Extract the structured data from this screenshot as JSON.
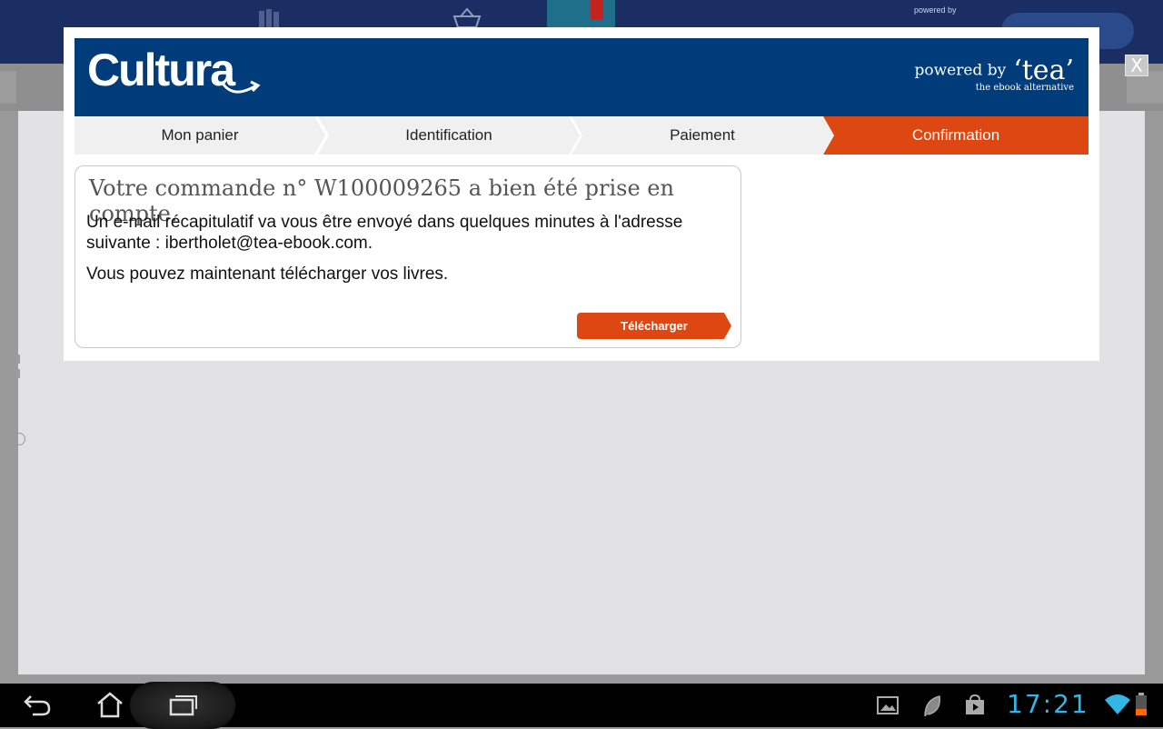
{
  "background_app": {
    "topbar_powered_by": "powered by"
  },
  "modal": {
    "brand": {
      "logo_text": "Cultura",
      "powered_by": "powered by",
      "tea": "‘tea’",
      "tagline": "the ebook alternative"
    },
    "steps": [
      {
        "label": "Mon panier",
        "active": false
      },
      {
        "label": "Identification",
        "active": false
      },
      {
        "label": "Paiement",
        "active": false
      },
      {
        "label": "Confirmation",
        "active": true
      }
    ],
    "confirmation": {
      "title": "Votre commande n° W100009265 a bien été prise en compte.",
      "email_message": "Un e-mail récapitulatif va vous être envoyé dans quelques minutes à l'adresse suivante : ibertholet@tea-ebook.com.",
      "download_message": "Vous pouvez maintenant télécharger vos livres.",
      "download_button": "Télécharger"
    },
    "close_label": "X"
  },
  "system_bar": {
    "clock": "17:21"
  },
  "colors": {
    "brand_blue": "#003c7a",
    "accent_orange": "#dc4712",
    "clock_blue": "#33b5e5"
  }
}
